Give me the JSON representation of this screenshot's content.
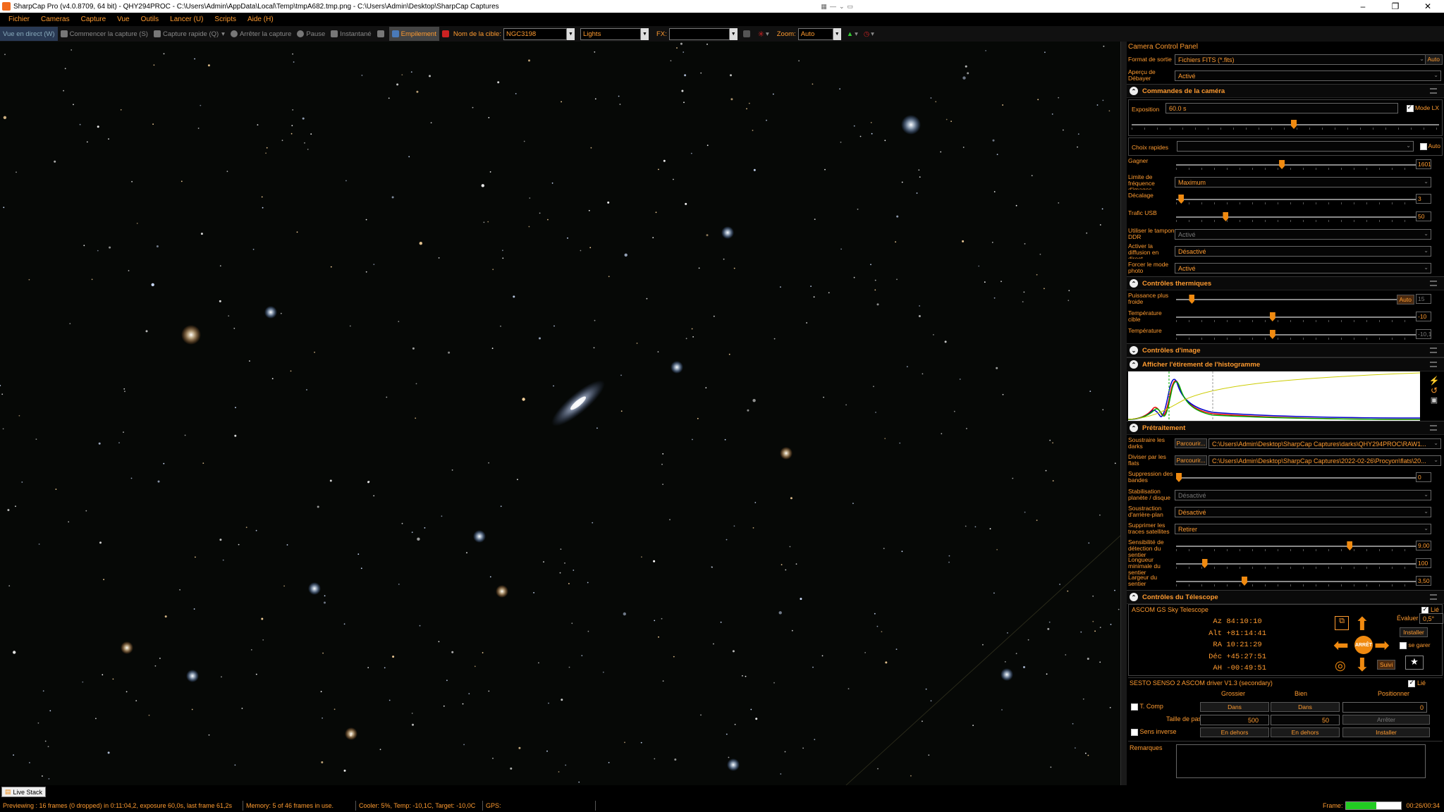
{
  "window": {
    "title": "SharpCap Pro (v4.0.8709, 64 bit) - QHY294PROC - C:\\Users\\Admin\\AppData\\Local\\Temp\\tmpA682.tmp.png - C:\\Users\\Admin\\Desktop\\SharpCap Captures",
    "min": "–",
    "max": "❐",
    "close": "✕"
  },
  "menu": [
    "Fichier",
    "Cameras",
    "Capture",
    "Vue",
    "Outils",
    "Lancer (U)",
    "Scripts",
    "Aide (H)"
  ],
  "toolbar": {
    "live_view": "Vue en direct (W)",
    "start_capture": "Commencer la capture (S)",
    "quick_capture": "Capture rapide (Q)",
    "stop_capture": "Arrêter la capture",
    "pause": "Pause",
    "snapshot": "Instantané",
    "stacking": "Empilement",
    "target_label": "Nom de la cible:",
    "target_value": "NGC3198",
    "frame_type": "Lights",
    "fx_label": "FX:",
    "fx_value": "",
    "zoom_label": "Zoom:",
    "zoom_value": "Auto"
  },
  "panel": {
    "title": "Camera Control Panel",
    "output_format_label": "Format de sortie",
    "output_format_value": "Fichiers FITS (*.fits)",
    "output_auto": "Auto",
    "debayer_label": "Aperçu de Débayer",
    "debayer_value": "Activé",
    "camera_section": "Commandes de la caméra",
    "exposure_label": "Exposition",
    "exposure_value": "60.0 s",
    "lx_mode": "Mode LX",
    "quick_picks_label": "Choix rapides",
    "quick_picks_auto": "Auto",
    "gain_label": "Gagner",
    "gain_value": "1601",
    "gain_level": 0.44,
    "framerate_label": "Limite de fréquence d'images",
    "framerate_value": "Maximum",
    "offset_label": "Décalage",
    "offset_value": "3",
    "offset_level": 0.01,
    "usb_label": "Trafic USB",
    "usb_value": "50",
    "usb_level": 0.2,
    "ddr_label": "Utiliser le tampon DDR",
    "ddr_value": "Activé",
    "broadcast_label": "Activer la diffusion en direct",
    "broadcast_value": "Désactivé",
    "photo_label": "Forcer le mode photo",
    "photo_value": "Activé",
    "thermal_section": "Contrôles thermiques",
    "cooler_label": "Puissance plus froide",
    "cooler_value": "15",
    "cooler_level": 0.06,
    "cooler_auto": "Auto",
    "target_temp_label": "Température cible",
    "target_temp_value": "-10",
    "target_temp_level": 0.4,
    "temp_label": "Température",
    "temp_value": "-10,1",
    "temp_level": 0.4,
    "image_section": "Contrôles d'image",
    "histogram_section": "Afficher l'étirement de l'histogramme",
    "preprocess_section": "Prétraitement",
    "darks_label": "Soustraire les darks",
    "darks_browse": "Parcourir...",
    "darks_path": "C:\\Users\\Admin\\Desktop\\SharpCap Captures\\darks\\QHY294PROC\\RAW1...",
    "flats_label": "Diviser par les flats",
    "flats_browse": "Parcourir...",
    "flats_path": "C:\\Users\\Admin\\Desktop\\SharpCap Captures\\2022-02-26\\Procyon\\flats\\20...",
    "banding_label": "Suppression des bandes",
    "banding_value": "0",
    "banding_level": 0.0,
    "stabilize_label": "Stabilisation planète / disque",
    "stabilize_value": "Désactivé",
    "bg_label": "Soustraction d'arrière-plan",
    "bg_value": "Désactivé",
    "sat_label": "Supprimer les traces satellites",
    "sat_value": "Retirer",
    "sens_label": "Sensibilité de détection du sentier",
    "sens_value": "9,00",
    "sens_level": 0.73,
    "minlen_label": "Longueur minimale du sentier",
    "minlen_value": "100",
    "minlen_level": 0.11,
    "width_label": "Largeur du sentier",
    "width_value": "3,50",
    "width_level": 0.28,
    "telescope_section": "Contrôles du Télescope",
    "scope_name": "ASCOM GS Sky Telescope",
    "connected": "Lié",
    "az_label": "Az",
    "az": "84:10:10",
    "alt_label": "Alt",
    "alt": "+81:14:41",
    "ra_label": "RA",
    "ra": "10:21:29",
    "dec_label": "Déc",
    "dec": "+45:27:51",
    "ah_label": "AH",
    "ah": "-00:49:51",
    "rate_label": "Évaluer",
    "rate_value": "0,5°",
    "install_btn": "Installer",
    "park_label": "se garer",
    "stop_btn": "ARRÊT",
    "track_btn": "Suivi",
    "focuser_name": "SESTO SENSO 2 ASCOM driver V1.3 (secondary)",
    "focuser_connected": "Lié",
    "coarse": "Grossier",
    "fine": "Bien",
    "position": "Positionner",
    "tcomp": "T. Comp",
    "in_btn": "Dans",
    "in_btn2": "Dans",
    "position_value": "0",
    "step_label": "Taille de pas",
    "coarse_step": "500",
    "fine_step": "50",
    "stop_focus": "Arrêter",
    "reverse": "Sens inverse",
    "out_btn": "En dehors",
    "out_btn2": "En dehors",
    "install_focus": "Installer",
    "notes_label": "Remarques"
  },
  "status": {
    "tab": "Live Stack",
    "preview": "Previewing : 16 frames (0 dropped) in 0:11:04,2, exposure 60,0s, last frame 61,2s",
    "memory": "Memory: 5 of 46 frames in use.",
    "cooler": "Cooler: 5%, Temp: -10,1C, Target: -10,0C",
    "gps": "GPS:",
    "frame_label": "Frame:",
    "frame_progress": 0.55,
    "time": "00:26/00:34"
  },
  "colors": {
    "accent": "#ff9b30",
    "thumb": "#f08a10",
    "progress": "#22cc22"
  }
}
